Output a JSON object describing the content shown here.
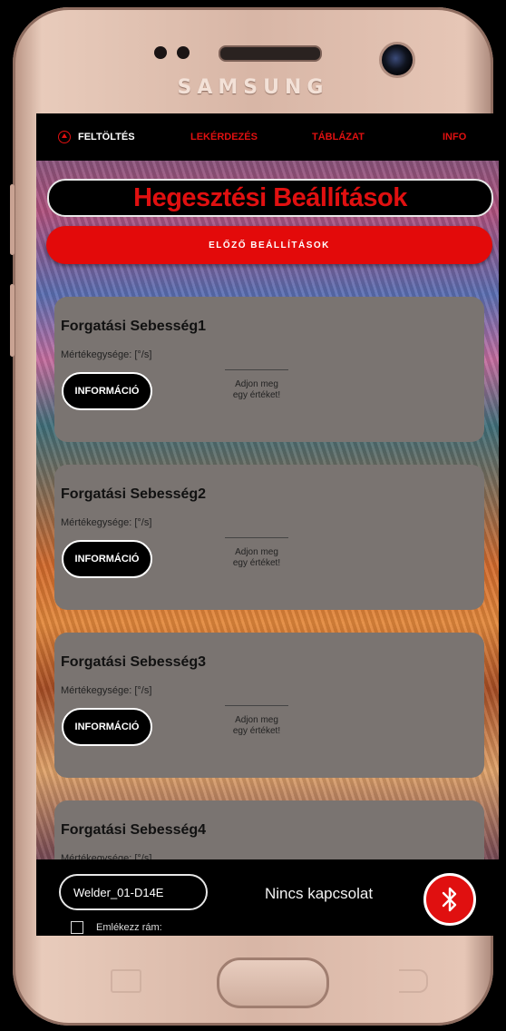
{
  "device": {
    "brand": "SAMSUNG"
  },
  "tabs": [
    {
      "label": "FELTÖLTÉS",
      "active": true
    },
    {
      "label": "LEKÉRDEZÉS",
      "active": false
    },
    {
      "label": "TÁBLÁZAT",
      "active": false
    },
    {
      "label": "INFO",
      "active": false
    }
  ],
  "header": {
    "title": "Hegesztési Beállítások"
  },
  "prev_settings_label": "ELŐZŐ BEÁLLÍTÁSOK",
  "cards": [
    {
      "title": "Forgatási Sebesség1",
      "unit": "Mértékegysége: [°/s]",
      "info_label": "INFORMÁCIÓ",
      "placeholder_line1": "Adjon meg",
      "placeholder_line2": "egy értéket!"
    },
    {
      "title": "Forgatási Sebesség2",
      "unit": "Mértékegysége: [°/s]",
      "info_label": "INFORMÁCIÓ",
      "placeholder_line1": "Adjon meg",
      "placeholder_line2": "egy értéket!"
    },
    {
      "title": "Forgatási Sebesség3",
      "unit": "Mértékegysége: [°/s]",
      "info_label": "INFORMÁCIÓ",
      "placeholder_line1": "Adjon meg",
      "placeholder_line2": "egy értéket!"
    },
    {
      "title": "Forgatási Sebesség4",
      "unit": "Mértékegysége: [°/s]"
    }
  ],
  "bottom": {
    "device_name": "Welder_01-D14E",
    "connection_status": "Nincs kapcsolat",
    "remember_label": "Emlékezz rám:"
  },
  "colors": {
    "accent": "#e01010",
    "card": "#7a7471"
  },
  "icons": {
    "bluetooth": "bluetooth-icon",
    "upload": "upload-icon"
  }
}
